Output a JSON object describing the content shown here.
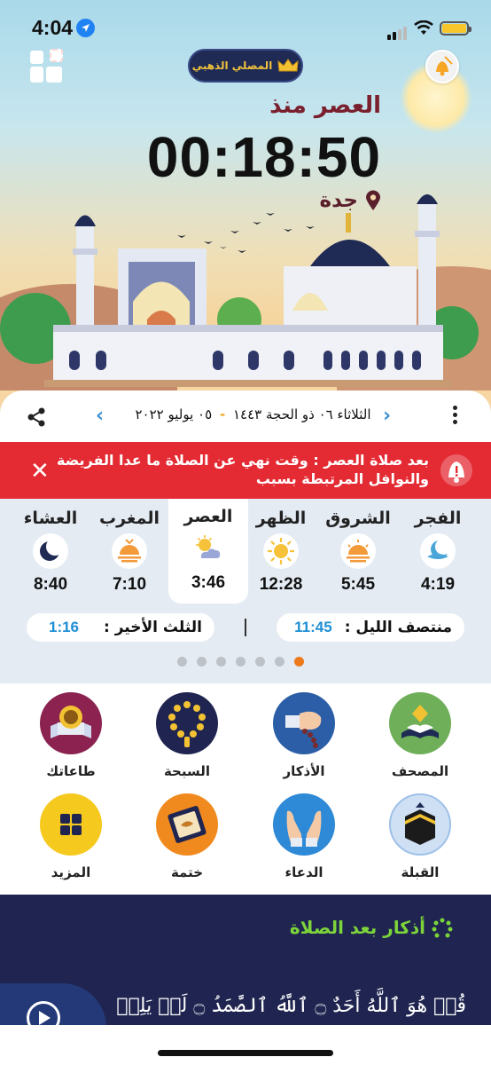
{
  "status_bar": {
    "time": "4:04"
  },
  "header": {
    "premium_label": "المصلي الذهبي",
    "since_label": "العصر منذ",
    "countdown": "00:18:50",
    "city": "جدة"
  },
  "date_bar": {
    "hijri": "الثلاثاء ٠٦ ذو الحجة ١٤٤٣",
    "separator": "-",
    "gregorian": "٠٥ يوليو ٢٠٢٢"
  },
  "alert": {
    "text": "بعد صلاة العصر : وقت نهي عن الصلاة ما عدا الفريضة والنوافل المرتبطة بسبب",
    "close": "✕"
  },
  "prayers": [
    {
      "name": "الفجر",
      "time": "4:19",
      "icon": "fajr-icon"
    },
    {
      "name": "الشروق",
      "time": "5:45",
      "icon": "sunrise-icon"
    },
    {
      "name": "الظهر",
      "time": "12:28",
      "icon": "sun-icon"
    },
    {
      "name": "العصر",
      "time": "3:46",
      "icon": "cloud-sun-icon"
    },
    {
      "name": "المغرب",
      "time": "7:10",
      "icon": "sunset-icon"
    },
    {
      "name": "العشاء",
      "time": "8:40",
      "icon": "moon-icon"
    }
  ],
  "night": {
    "midnight_label": "منتصف الليل :",
    "midnight_value": "11:45",
    "last_third_label": "الثلث الأخير :",
    "last_third_value": "1:16"
  },
  "pager": {
    "count": 7,
    "active": 6
  },
  "features": [
    {
      "label": "المصحف",
      "icon": "quran-icon"
    },
    {
      "label": "الأذكار",
      "icon": "dhikr-hand-icon"
    },
    {
      "label": "السبحة",
      "icon": "tasbih-icon"
    },
    {
      "label": "طاعاتك",
      "icon": "medal-icon"
    },
    {
      "label": "القبلة",
      "icon": "kaaba-icon"
    },
    {
      "label": "الدعاء",
      "icon": "dua-hands-icon"
    },
    {
      "label": "ختمة",
      "icon": "khatma-book-icon"
    },
    {
      "label": "المزيد",
      "icon": "more-grid-icon"
    }
  ],
  "adhkar": {
    "title": "أذكار بعد الصلاة",
    "verse": "قُلۡ هُوَ ٱللَّهُ أَحَدٌ ۝ ٱللَّهُ ٱلصَّمَدُ ۝ لَمۡ يَلِدۡ"
  },
  "colors": {
    "alert_red": "#e42b34",
    "accent_orange": "#ec7a1c",
    "time_blue": "#1e8fd4",
    "navy": "#1f2550",
    "adhkar_green": "#7cd43a"
  }
}
